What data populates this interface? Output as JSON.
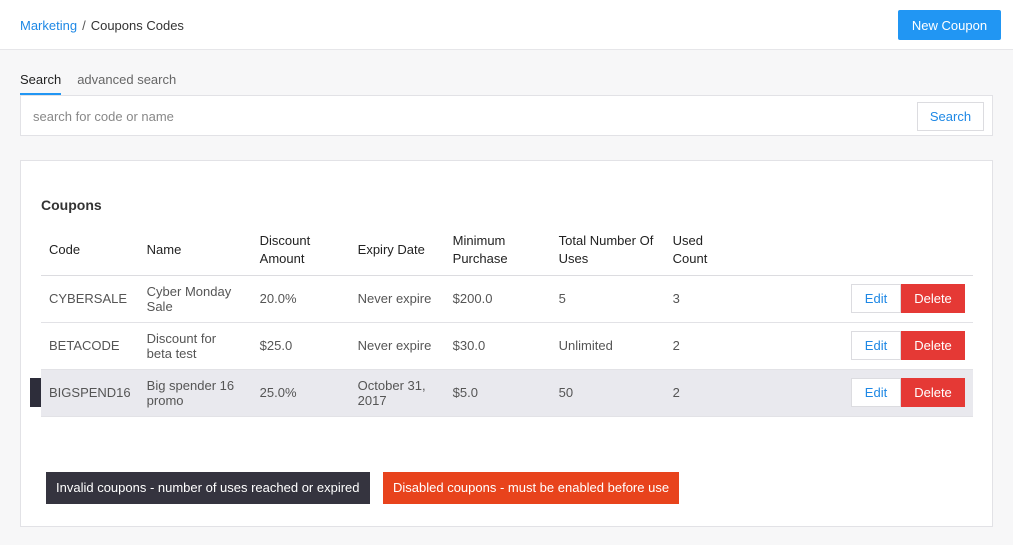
{
  "breadcrumb": {
    "parent": "Marketing",
    "separator": "/",
    "current": "Coupons Codes"
  },
  "header": {
    "new_button": "New Coupon"
  },
  "tabs": [
    {
      "label": "Search",
      "active": true
    },
    {
      "label": "advanced search",
      "active": false
    }
  ],
  "search": {
    "placeholder": "search for code or name",
    "value": "",
    "button": "Search"
  },
  "coupons": {
    "title": "Coupons",
    "columns": [
      "Code",
      "Name",
      "Discount Amount",
      "Expiry Date",
      "Minimum Purchase",
      "Total Number Of Uses",
      "Used Count"
    ],
    "rows": [
      {
        "code": "CYBERSALE",
        "name": "Cyber Monday Sale",
        "discount": "20.0%",
        "expiry": "Never expire",
        "minimum": "$200.0",
        "total_uses": "5",
        "used": "3",
        "edit": "Edit",
        "delete": "Delete"
      },
      {
        "code": "BETACODE",
        "name": "Discount for beta test",
        "discount": "$25.0",
        "expiry": "Never expire",
        "minimum": "$30.0",
        "total_uses": "Unlimited",
        "used": "2",
        "edit": "Edit",
        "delete": "Delete"
      },
      {
        "code": "BIGSPEND16",
        "name": "Big spender 16 promo",
        "discount": "25.0%",
        "expiry": "October 31, 2017",
        "minimum": "$5.0",
        "total_uses": "50",
        "used": "2",
        "edit": "Edit",
        "delete": "Delete"
      }
    ]
  },
  "legend": {
    "invalid": "Invalid coupons - number of uses reached or expired",
    "disabled": "Disabled coupons - must be enabled before use"
  },
  "colors": {
    "accent": "#2196f3",
    "danger": "#e53935",
    "invalid": "#35343f",
    "disabled": "#e8431c"
  }
}
